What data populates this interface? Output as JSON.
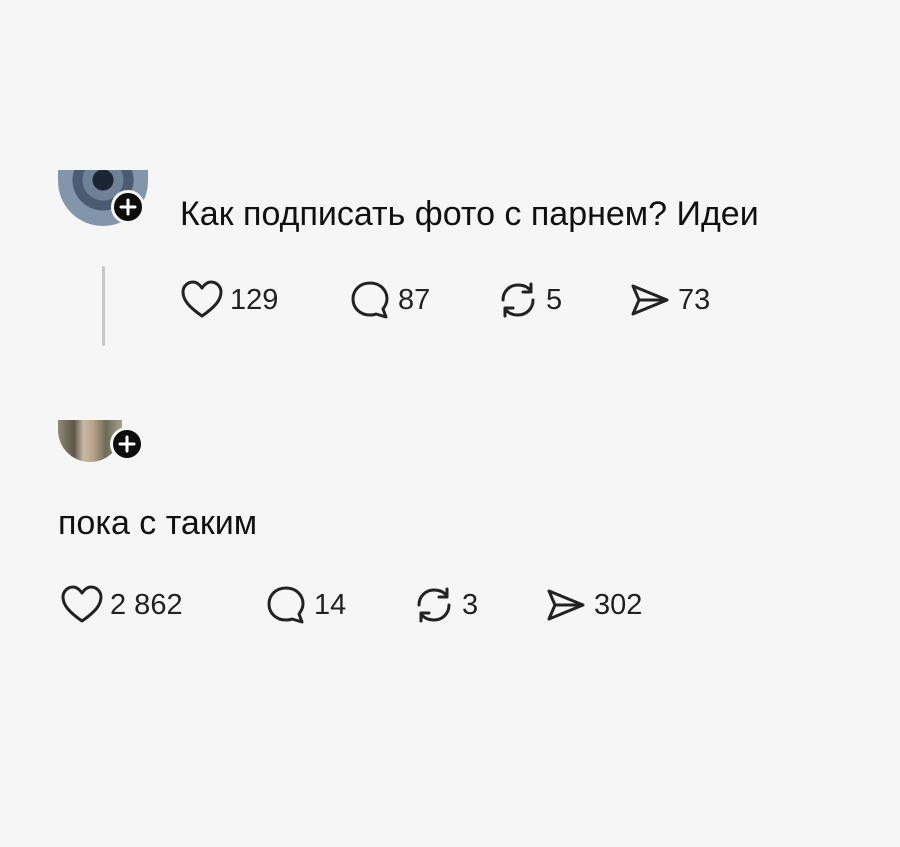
{
  "posts": [
    {
      "text": "Как подписать фото с парнем? Идеи",
      "actions": {
        "likes": "129",
        "comments": "87",
        "reposts": "5",
        "shares": "73"
      }
    },
    {
      "text": "пока с таким",
      "actions": {
        "likes": "2 862",
        "comments": "14",
        "reposts": "3",
        "shares": "302"
      }
    }
  ],
  "icons": {
    "like": "heart-icon",
    "comment": "comment-bubble-icon",
    "repost": "repost-arrows-icon",
    "share": "send-paper-plane-icon",
    "follow": "plus-icon"
  },
  "colors": {
    "background": "#f6f6f6",
    "text": "#111111",
    "badge": "#0d0d0d"
  }
}
